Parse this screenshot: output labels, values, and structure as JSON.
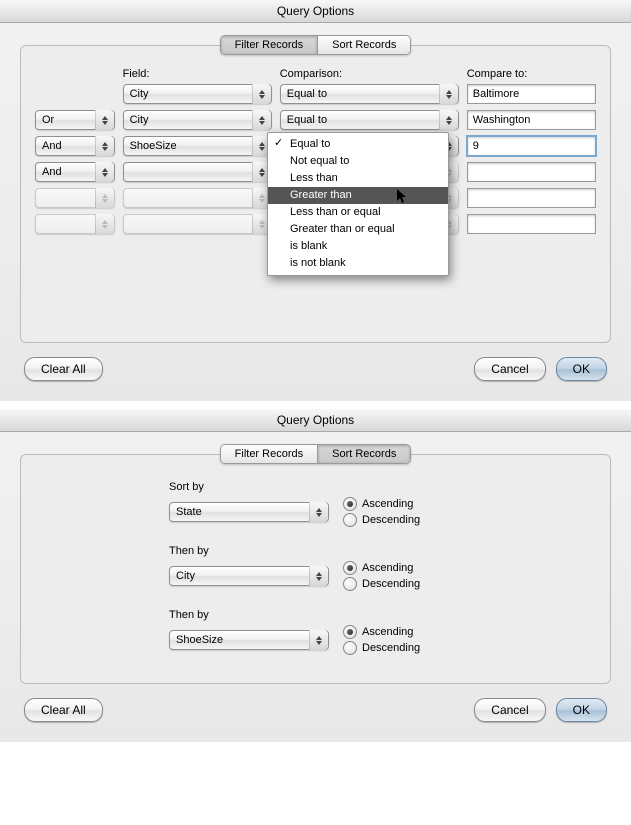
{
  "top": {
    "title": "Query Options",
    "tabs": {
      "filter": "Filter Records",
      "sort": "Sort Records"
    },
    "activeTab": "filter",
    "header": {
      "field": "Field:",
      "comparison": "Comparison:",
      "compareTo": "Compare to:"
    },
    "rows": [
      {
        "logic": "",
        "field": "City",
        "comparison": "Equal to",
        "value": "Baltimore",
        "logicEnabled": false,
        "fieldEnabled": true,
        "compEnabled": true,
        "valueFocus": false
      },
      {
        "logic": "Or",
        "field": "City",
        "comparison": "Equal to",
        "value": "Washington",
        "logicEnabled": true,
        "fieldEnabled": true,
        "compEnabled": true,
        "valueFocus": false
      },
      {
        "logic": "And",
        "field": "ShoeSize",
        "comparison": "",
        "value": "9",
        "logicEnabled": true,
        "fieldEnabled": true,
        "compEnabled": true,
        "valueFocus": true
      },
      {
        "logic": "And",
        "field": "",
        "comparison": "",
        "value": "",
        "logicEnabled": true,
        "fieldEnabled": true,
        "compEnabled": false,
        "valueFocus": false
      },
      {
        "logic": "",
        "field": "",
        "comparison": "",
        "value": "",
        "logicEnabled": false,
        "fieldEnabled": false,
        "compEnabled": false,
        "valueFocus": false
      },
      {
        "logic": "",
        "field": "",
        "comparison": "",
        "value": "",
        "logicEnabled": false,
        "fieldEnabled": false,
        "compEnabled": false,
        "valueFocus": false
      }
    ],
    "popup": {
      "items": [
        "Equal to",
        "Not equal to",
        "Less than",
        "Greater than",
        "Less than or equal",
        "Greater than or equal",
        "is blank",
        "is not blank"
      ],
      "checked": "Equal to",
      "highlighted": "Greater than"
    },
    "buttons": {
      "clear": "Clear All",
      "cancel": "Cancel",
      "ok": "OK"
    }
  },
  "bottom": {
    "title": "Query Options",
    "tabs": {
      "filter": "Filter Records",
      "sort": "Sort Records"
    },
    "activeTab": "sort",
    "labels": {
      "sortBy": "Sort by",
      "thenBy": "Then by",
      "asc": "Ascending",
      "desc": "Descending"
    },
    "sorts": [
      {
        "field": "State",
        "dir": "asc"
      },
      {
        "field": "City",
        "dir": "asc"
      },
      {
        "field": "ShoeSize",
        "dir": "asc"
      }
    ],
    "buttons": {
      "clear": "Clear All",
      "cancel": "Cancel",
      "ok": "OK"
    }
  }
}
